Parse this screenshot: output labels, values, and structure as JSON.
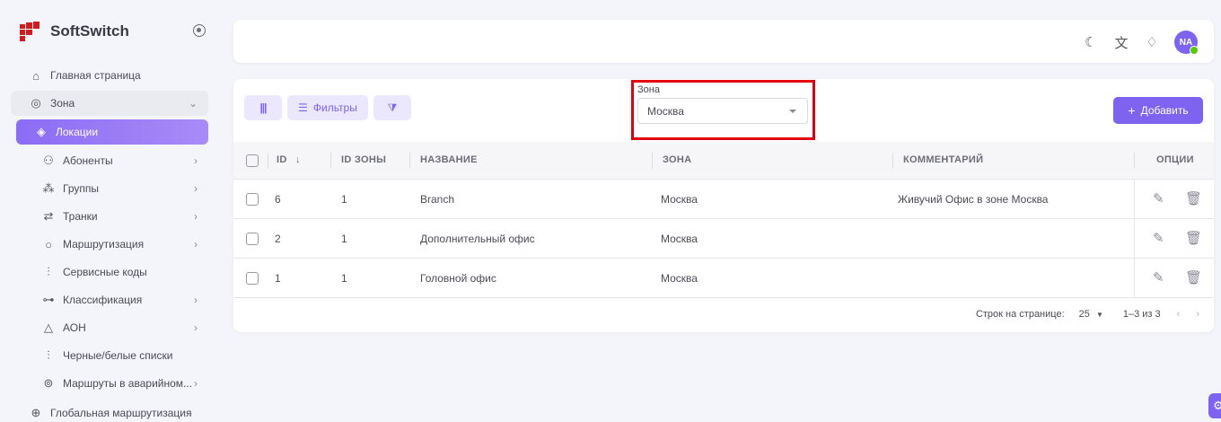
{
  "app": {
    "name": "SoftSwitch"
  },
  "sidebar": {
    "items": [
      {
        "label": "Главная страница",
        "icon": "home-icon"
      },
      {
        "label": "Зона",
        "icon": "location-pin-icon"
      },
      {
        "label": "Локации",
        "icon": "target-icon"
      },
      {
        "label": "Абоненты",
        "icon": "users-icon"
      },
      {
        "label": "Группы",
        "icon": "group-icon"
      },
      {
        "label": "Транки",
        "icon": "arrows-icon"
      },
      {
        "label": "Маршрутизация",
        "icon": "circle-icon"
      },
      {
        "label": "Сервисные коды",
        "icon": "sliders-icon"
      },
      {
        "label": "Классификация",
        "icon": "hierarchy-icon"
      },
      {
        "label": "АОН",
        "icon": "triangle-nodes-icon"
      },
      {
        "label": "Черные/белые списки",
        "icon": "sliders-icon"
      },
      {
        "label": "Маршруты в аварийном...",
        "icon": "broadcast-icon"
      },
      {
        "label": "Глобальная маршрутизация",
        "icon": "globe-icon"
      }
    ]
  },
  "toolbar": {
    "filters_label": "Фильтры",
    "zone_label": "Зона",
    "zone_value": "Москва",
    "add_label": "Добавить"
  },
  "table": {
    "headers": [
      "ID",
      "ID ЗОНЫ",
      "НАЗВАНИЕ",
      "ЗОНА",
      "КОММЕНТАРИЙ",
      "ОПЦИИ"
    ],
    "rows": [
      {
        "id": "6",
        "zone_id": "1",
        "name": "Branch",
        "zone": "Москва",
        "comment": "Живучий Офис в зоне Москва"
      },
      {
        "id": "2",
        "zone_id": "1",
        "name": "Дополнительный офис",
        "zone": "Москва",
        "comment": ""
      },
      {
        "id": "1",
        "zone_id": "1",
        "name": "Головной офис",
        "zone": "Москва",
        "comment": ""
      }
    ]
  },
  "pagination": {
    "rows_per_page_label": "Строк на странице:",
    "rows_per_page": "25",
    "range": "1–3 из 3"
  },
  "user": {
    "initials": "NA"
  },
  "colors": {
    "accent": "#7e63f0",
    "highlight": "#e3000f"
  }
}
